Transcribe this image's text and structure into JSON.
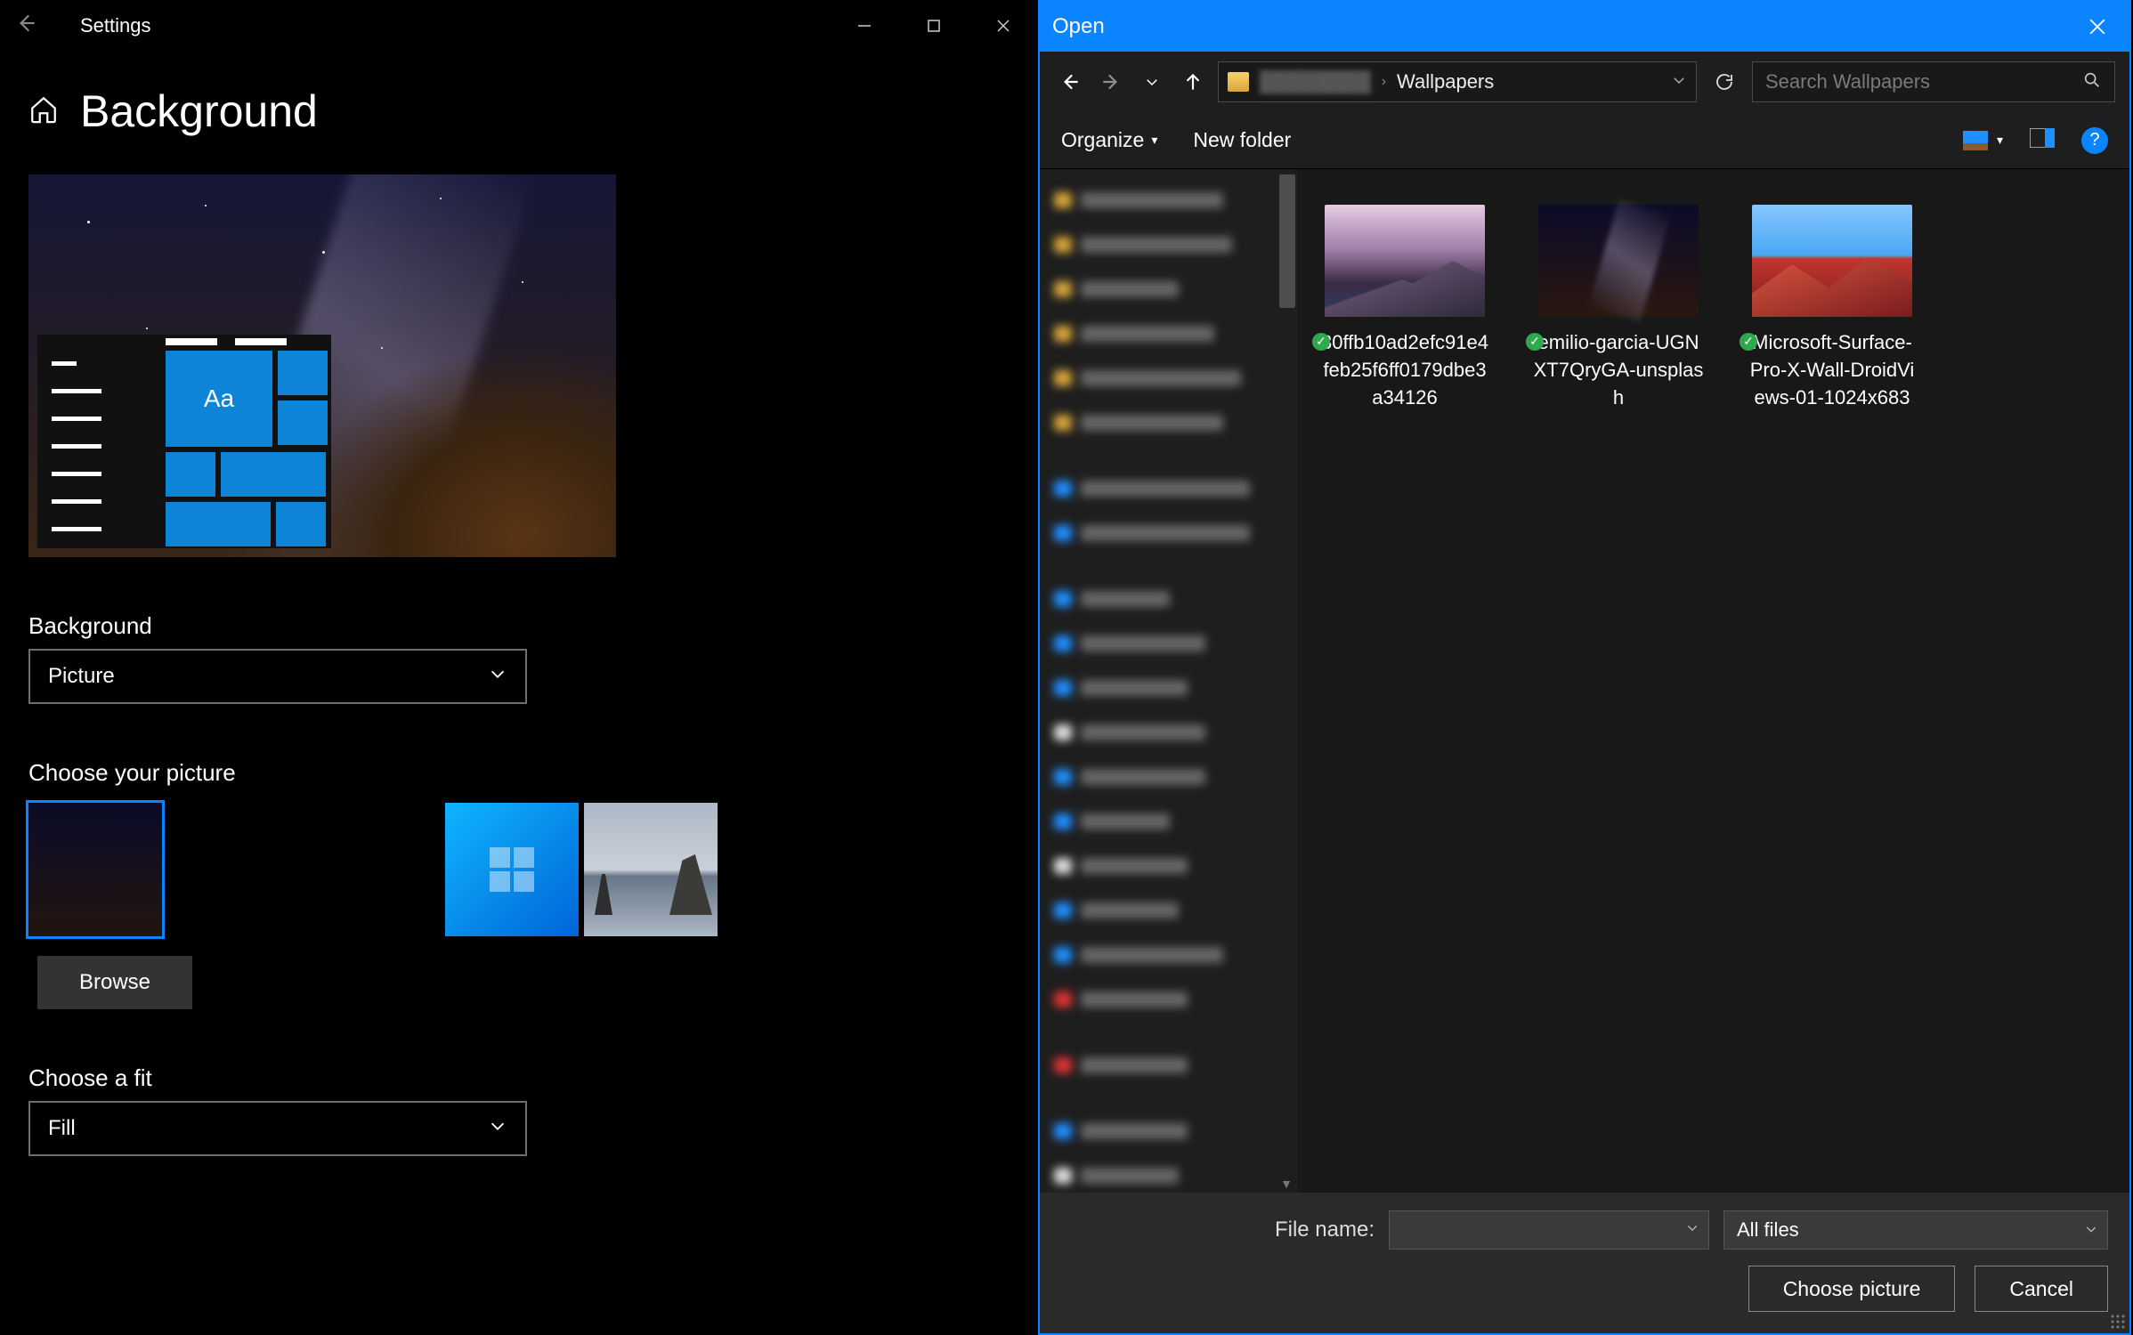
{
  "settings": {
    "title": "Settings",
    "heading": "Background",
    "preview_tile_text": "Aa",
    "background_label": "Background",
    "background_value": "Picture",
    "choose_picture_label": "Choose your picture",
    "browse_label": "Browse",
    "choose_fit_label": "Choose a fit",
    "fit_value": "Fill"
  },
  "dialog": {
    "title": "Open",
    "breadcrumb_current": "Wallpapers",
    "search_placeholder": "Search Wallpapers",
    "organize_label": "Organize",
    "new_folder_label": "New folder",
    "files": [
      {
        "name": "30ffb10ad2efc91e4feb25f6ff0179dbe3a34126"
      },
      {
        "name": "emilio-garcia-UGNXT7QryGA-unsplash"
      },
      {
        "name": "Microsoft-Surface-Pro-X-Wall-DroidViews-01-1024x683"
      }
    ],
    "filename_label": "File name:",
    "filter_value": "All files",
    "choose_button": "Choose picture",
    "cancel_button": "Cancel"
  }
}
